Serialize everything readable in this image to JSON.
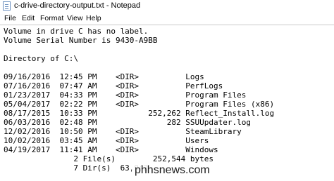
{
  "window": {
    "title": "c-drive-directory-output.txt - Notepad",
    "app_icon": "notepad-icon"
  },
  "menu": {
    "file": "File",
    "edit": "Edit",
    "format": "Format",
    "view": "View",
    "help": "Help"
  },
  "editor": {
    "content": "Volume in drive C has no label.\nVolume Serial Number is 9430-A9BB\n\nDirectory of C:\\\n\n09/16/2016  12:45 PM    <DIR>          Logs\n07/16/2016  07:47 AM    <DIR>          PerfLogs\n01/23/2017  04:33 PM    <DIR>          Program Files\n05/04/2017  02:22 PM    <DIR>          Program Files (x86)\n08/17/2015  10:33 PM           252,262 Reflect_Install.log\n06/03/2016  02:48 PM               282 SSUUpdater.log\n12/02/2016  10:50 PM    <DIR>          SteamLibrary\n10/02/2016  03:45 AM    <DIR>          Users\n04/19/2017  11:41 AM    <DIR>          Windows\n               2 File(s)        252,544 bytes\n               7 Dir(s)  63,942"
  },
  "watermark": {
    "text": "phhsnews.com"
  }
}
